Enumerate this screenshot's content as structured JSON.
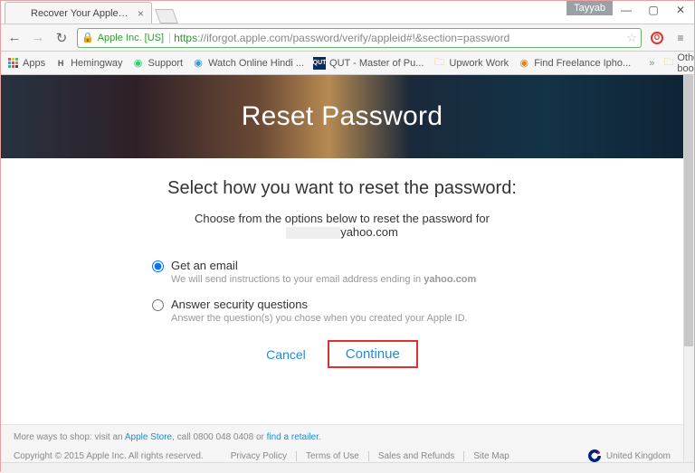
{
  "browser": {
    "user_chip": "Tayyab",
    "tab": {
      "title": "Recover Your Apple ID - A"
    },
    "ev_badge": "Apple Inc. [US]",
    "url_scheme": "https",
    "url_rest": "://iforgot.apple.com/password/verify/appleid#!&section=password",
    "bookmarks": {
      "apps": "Apps",
      "items": [
        "Hemingway",
        "Support",
        "Watch Online Hindi ...",
        "QUT - Master of Pu...",
        "Upwork Work",
        "Find Freelance Ipho..."
      ],
      "other": "Other bookmarks"
    }
  },
  "hero": {
    "title": "Reset Password"
  },
  "content": {
    "heading": "Select how you want to reset the password:",
    "choose_prefix": "Choose from the options below to reset the password for",
    "email_suffix": "yahoo.com",
    "options": [
      {
        "label": "Get an email",
        "hint_prefix": "We will send instructions to your email address ending in ",
        "hint_bold": "yahoo.com",
        "checked": true
      },
      {
        "label": "Answer security questions",
        "hint": "Answer the question(s) you chose when you created your Apple ID.",
        "checked": false
      }
    ],
    "cancel": "Cancel",
    "continue": "Continue"
  },
  "footer": {
    "shop_prefix": "More ways to shop: visit an ",
    "apple_store": "Apple Store",
    "shop_mid": ", call 0800 048 0408 or ",
    "find_retailer": "find a retailer",
    "copyright": "Copyright © 2015 Apple Inc. All rights reserved.",
    "links": [
      "Privacy Policy",
      "Terms of Use",
      "Sales and Refunds",
      "Site Map"
    ],
    "region": "United Kingdom"
  }
}
